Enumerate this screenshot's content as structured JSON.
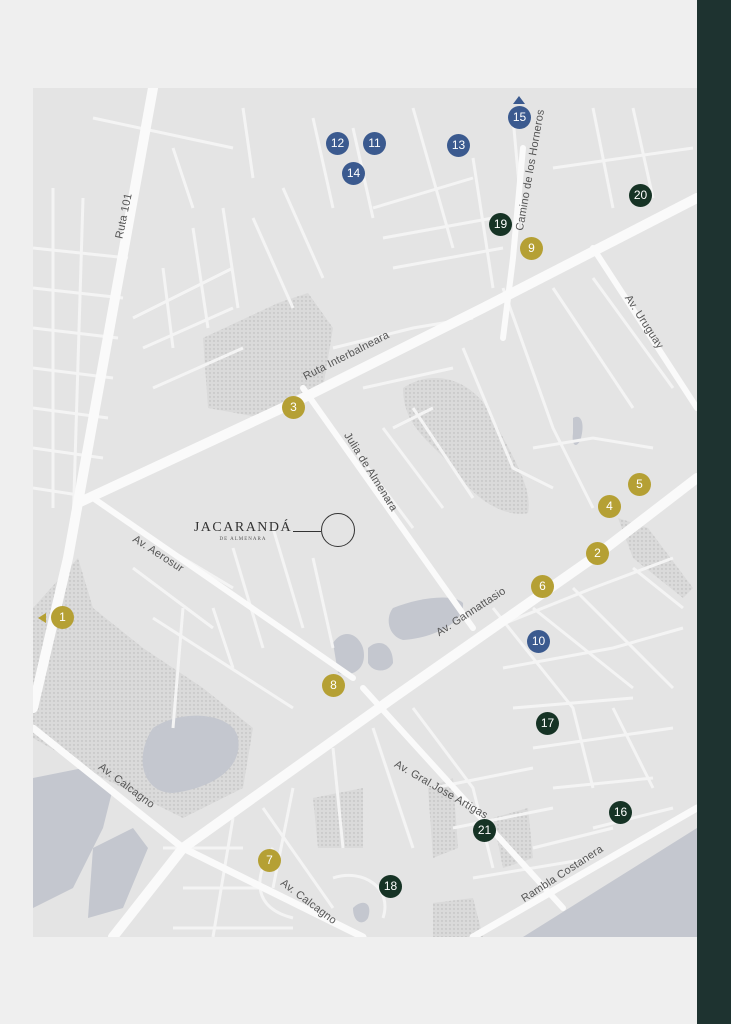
{
  "map": {
    "street_labels": {
      "ruta_101": "Ruta 101",
      "ruta_interbalneara": "Ruta Interbalneara",
      "camino_horneros": "Camino de los Horneros",
      "av_uruguay": "Av. Uruguay",
      "julia_almenara": "Julia de Almenara",
      "av_aerosur": "Av. Aerosur",
      "av_gannattasio": "Av. Gannattasio",
      "av_calcagno_1": "Av. Calcagno",
      "av_calcagno_2": "Av. Calcagno",
      "av_artigas": "Av. Gral.Jose Artigas",
      "rambla_costanera": "Rambla Costanera"
    },
    "logo": {
      "name": "JACARANDÁ",
      "subtitle": "DE ALMENARA"
    },
    "markers": [
      {
        "id": "1",
        "color": "gold"
      },
      {
        "id": "2",
        "color": "gold"
      },
      {
        "id": "3",
        "color": "gold"
      },
      {
        "id": "4",
        "color": "gold"
      },
      {
        "id": "5",
        "color": "gold"
      },
      {
        "id": "6",
        "color": "gold"
      },
      {
        "id": "7",
        "color": "gold"
      },
      {
        "id": "8",
        "color": "gold"
      },
      {
        "id": "9",
        "color": "gold"
      },
      {
        "id": "10",
        "color": "blue"
      },
      {
        "id": "11",
        "color": "blue"
      },
      {
        "id": "12",
        "color": "blue"
      },
      {
        "id": "13",
        "color": "blue"
      },
      {
        "id": "14",
        "color": "blue"
      },
      {
        "id": "15",
        "color": "blue"
      },
      {
        "id": "16",
        "color": "green"
      },
      {
        "id": "17",
        "color": "green"
      },
      {
        "id": "18",
        "color": "green"
      },
      {
        "id": "19",
        "color": "green"
      },
      {
        "id": "20",
        "color": "green"
      },
      {
        "id": "21",
        "color": "green"
      }
    ],
    "colors": {
      "gold": "#b5a034",
      "blue": "#3b5a8f",
      "green": "#163325",
      "sidebar": "#1e3330",
      "water": "#c4c7cf",
      "road_major": "#f7f7f7",
      "land": "#e4e4e4"
    }
  }
}
